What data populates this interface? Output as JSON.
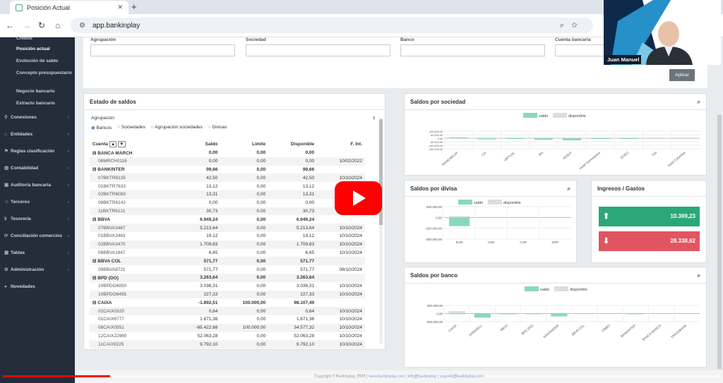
{
  "browser": {
    "tab_title": "Posición Actual",
    "url": "app.bankinplay"
  },
  "sidebar": {
    "sub_items": [
      "Crédito",
      "Posición actual",
      "Evolución de saldo",
      "Concepto presupuestario",
      "Negocio bancario",
      "Extracto bancario"
    ],
    "items": [
      {
        "label": "Conexiones",
        "icon": "plug-icon"
      },
      {
        "label": "Entidades",
        "icon": "bank-icon"
      },
      {
        "label": "Reglas clasificación",
        "icon": "tag-icon"
      },
      {
        "label": "Contabilidad",
        "icon": "book-icon"
      },
      {
        "label": "Auditoría bancaria",
        "icon": "audit-icon"
      },
      {
        "label": "Terceros",
        "icon": "users-icon"
      },
      {
        "label": "Tesorería",
        "icon": "treasury-icon"
      },
      {
        "label": "Conciliación comercios",
        "icon": "sync-icon"
      },
      {
        "label": "Tablas",
        "icon": "table-icon"
      },
      {
        "label": "Administración",
        "icon": "gear-icon"
      },
      {
        "label": "Novedades",
        "icon": "info-icon"
      }
    ]
  },
  "filters": {
    "labels": [
      "Agrupación",
      "Sociedad",
      "Banco",
      "Cuenta bancaria"
    ],
    "apply": "Aplicar"
  },
  "estado": {
    "title": "Estado de saldos",
    "group_label": "Agrupación",
    "options": [
      "Bancos",
      "Sociedades",
      "Agrupación sociedades",
      "Divisas"
    ],
    "columns": [
      "Cuenta",
      "Saldo",
      "Límite",
      "Disponible",
      "F. Int."
    ],
    "rows": [
      {
        "g": 1,
        "c": "⊟ BANCA MARCH",
        "s": "0,00",
        "l": "0,00",
        "d": "0,00",
        "f": ""
      },
      {
        "g": 0,
        "c": "06MRCH0116",
        "s": "0,00",
        "l": "0,00",
        "d": "0,00",
        "f": "10/02/2022"
      },
      {
        "g": 1,
        "c": "⊟ BANKINTER",
        "s": "99,66",
        "l": "0,00",
        "d": "99,66",
        "f": ""
      },
      {
        "g": 0,
        "c": "07BKTR6135",
        "s": "42,50",
        "l": "0,00",
        "d": "42,50",
        "f": "10/10/2024"
      },
      {
        "g": 0,
        "c": "01BKTR7633",
        "s": "13,12",
        "l": "0,00",
        "d": "13,12",
        "f": "10/10/2024"
      },
      {
        "g": 0,
        "c": "02BKTR6093",
        "s": "13,31",
        "l": "0,00",
        "d": "13,31",
        "f": ""
      },
      {
        "g": 0,
        "c": "08BKTR6142",
        "s": "0,00",
        "l": "0,00",
        "d": "0,00",
        "f": ""
      },
      {
        "g": 0,
        "c": "11BKTR6121",
        "s": "30,73",
        "l": "0,00",
        "d": "30,73",
        "f": ""
      },
      {
        "g": 1,
        "c": "⊟ BBVA",
        "s": "6.949,24",
        "l": "0,00",
        "d": "6.949,24",
        "f": ""
      },
      {
        "g": 0,
        "c": "07BBVA3487",
        "s": "5.213,64",
        "l": "0,00",
        "d": "5.213,64",
        "f": "10/10/2024"
      },
      {
        "g": 0,
        "c": "01BBVA3463",
        "s": "19,12",
        "l": "0,00",
        "d": "19,12",
        "f": "10/10/2024"
      },
      {
        "g": 0,
        "c": "02BBVA3470",
        "s": "1.709,83",
        "l": "0,00",
        "d": "1.709,83",
        "f": "10/10/2024"
      },
      {
        "g": 0,
        "c": "08BBVA1847",
        "s": "6,65",
        "l": "0,00",
        "d": "6,65",
        "f": "10/10/2024"
      },
      {
        "g": 1,
        "c": "⊟ BBVA COL",
        "s": "571,77",
        "l": "0,00",
        "d": "571,77",
        "f": ""
      },
      {
        "g": 0,
        "c": "09BBVA8721",
        "s": "571,77",
        "l": "0,00",
        "d": "571,77",
        "f": "08/10/2024"
      },
      {
        "g": 1,
        "c": "⊟ BPD (DO)",
        "s": "3.263,64",
        "l": "0,00",
        "d": "3.263,64",
        "f": ""
      },
      {
        "g": 0,
        "c": "10BPDO6850",
        "s": "3.036,31",
        "l": "0,00",
        "d": "3.036,31",
        "f": "10/10/2024"
      },
      {
        "g": 0,
        "c": "10BPDO6495",
        "s": "227,33",
        "l": "0,00",
        "d": "227,33",
        "f": "10/10/2024"
      },
      {
        "g": 1,
        "c": "⊟ CAIXA",
        "s": "-1.892,51",
        "l": "100.000,00",
        "d": "98.107,49",
        "f": ""
      },
      {
        "g": 0,
        "c": "02CAIX0325",
        "s": "0,64",
        "l": "0,00",
        "d": "0,64",
        "f": "10/10/2024"
      },
      {
        "g": 0,
        "c": "01CAIX6777",
        "s": "1.671,36",
        "l": "0,00",
        "d": "1.671,36",
        "f": "10/10/2024"
      },
      {
        "g": 0,
        "c": "08CAIX0551",
        "s": "-65.422,68",
        "l": "100.000,00",
        "d": "34.577,32",
        "f": "10/10/2024"
      },
      {
        "g": 0,
        "c": "12CAIX22960",
        "s": "52.063,28",
        "l": "0,00",
        "d": "52.063,28",
        "f": "10/10/2024"
      },
      {
        "g": 0,
        "c": "11CAIX9225",
        "s": "9.792,10",
        "l": "0,00",
        "d": "9.792,10",
        "f": "10/10/2024"
      }
    ]
  },
  "charts": {
    "sociedad": {
      "title": "Saldos por sociedad",
      "legend": [
        "saldo",
        "disponible"
      ],
      "yticks": [
        "100.000,00",
        "50.000,00",
        "0,00",
        "-50.000,00",
        "-100.000,00",
        "-150.000,00"
      ],
      "categories": [
        "BANKINPLAY",
        "CIF",
        "VIRTUAL",
        "IPA",
        "HGIEO",
        "Hotel Garmoquina",
        "DGEO",
        "YIH",
        "Hotel Colombia"
      ],
      "saldo": [
        12000,
        -15000,
        -6000,
        -22000,
        -30000,
        -2000,
        -10000,
        0,
        0
      ]
    },
    "divisa": {
      "title": "Saldos por divisa",
      "legend": [
        "saldo",
        "disponible"
      ],
      "yticks": [
        "200.000,00",
        "0,00",
        "-200.000,00",
        "-400.000,00"
      ],
      "categories": [
        "EUR",
        "USD",
        "COP",
        "DOP"
      ],
      "saldo": [
        -160000,
        0,
        0,
        0
      ],
      "disponible": [
        25000,
        0,
        0,
        0
      ]
    },
    "banco": {
      "title": "Saldos por banco",
      "legend": [
        "saldo",
        "disponible"
      ],
      "yticks": [
        "200.000,00",
        "0,00",
        "-200.000,00"
      ],
      "categories": [
        "CAIXA",
        "SABADELL",
        "BBVA",
        "BPD (DO)",
        "SANTANDER",
        "BBVA COL",
        "CBIBO",
        "BANKINTER",
        "BANCA MARCH",
        "TARGOBANK"
      ],
      "saldo": [
        -2000,
        -100000,
        -8000,
        3000,
        -70000,
        6000,
        0,
        1000,
        0,
        0
      ],
      "disponible": [
        60000,
        0,
        0,
        0,
        0,
        0,
        0,
        0,
        0,
        0
      ]
    }
  },
  "ingresos": {
    "title": "Ingresos / Gastos",
    "ingresos": "10.369,23",
    "gastos": "28.338,62",
    "colors": {
      "in": "#2aa87a",
      "out": "#e05561"
    }
  },
  "footer": {
    "copyright": "Copyright © Bankinplay, 2024 |",
    "links": [
      "www.bankinplay.com",
      "info@bankinplay",
      "soporte@bankinplay.com"
    ]
  },
  "video": {
    "person_name": "Juan Manuel"
  }
}
